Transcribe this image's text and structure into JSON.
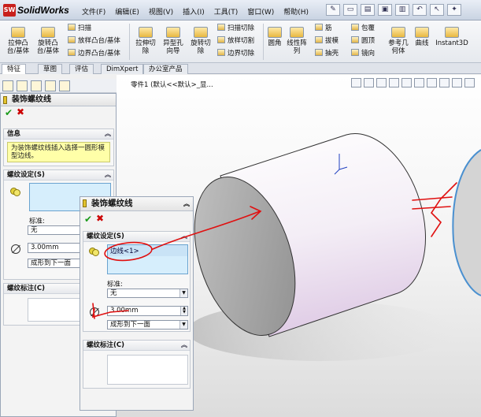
{
  "app": {
    "logo_text": "SW",
    "name": "SolidWorks"
  },
  "menu": [
    "文件(F)",
    "编辑(E)",
    "视图(V)",
    "插入(I)",
    "工具(T)",
    "窗口(W)",
    "帮助(H)"
  ],
  "ribbon": {
    "extrude_boss": "拉伸凸\n台/基体",
    "revolve_boss": "旋转凸\n台/基体",
    "sweep": "扫描",
    "loft_boss": "放样凸台/基体",
    "boundary_boss": "边界凸台/基体",
    "extrude_cut": "拉伸切\n除",
    "hole_wizard": "异型孔\n向导",
    "revolve_cut": "旋转切\n除",
    "swept_cut": "扫描切除",
    "lofted_cut": "放样切割",
    "boundary_cut": "边界切除",
    "fillet": "圆角",
    "linear_pattern": "线性阵\n列",
    "rib": "筋",
    "draft": "拔模",
    "shell": "抽壳",
    "wrap": "包覆",
    "dome": "圆顶",
    "mirror": "镜向",
    "ref_geometry": "参考几\n何体",
    "curves": "曲线",
    "instant3d": "Instant3D"
  },
  "tabs": [
    "特征",
    "草图",
    "评估",
    "DimXpert",
    "办公室产品"
  ],
  "breadcrumb": "零件1 (默认<<默认>_显...",
  "pm_back": {
    "title": "装饰螺纹线",
    "info_header": "信息",
    "info_text": "为装饰螺纹线插入选择一圆形模型边线。",
    "settings_header": "螺纹设定(S)",
    "standard_label": "标准:",
    "standard_value": "无",
    "diameter_value": "3.00mm",
    "end_condition": "成形到下一面",
    "notes_header": "螺纹标注(C)"
  },
  "pm_front": {
    "title": "装饰螺纹线",
    "settings_header": "螺纹设定(S)",
    "edge_item": "边线<1>",
    "standard_label": "标准:",
    "standard_value": "无",
    "diameter_value": "3.00mm",
    "end_condition": "成形到下一面",
    "notes_header": "螺纹标注(C)"
  },
  "colors": {
    "annotation": "#e01010",
    "accent": "#1a9a1a",
    "cancel": "#cc0000"
  }
}
